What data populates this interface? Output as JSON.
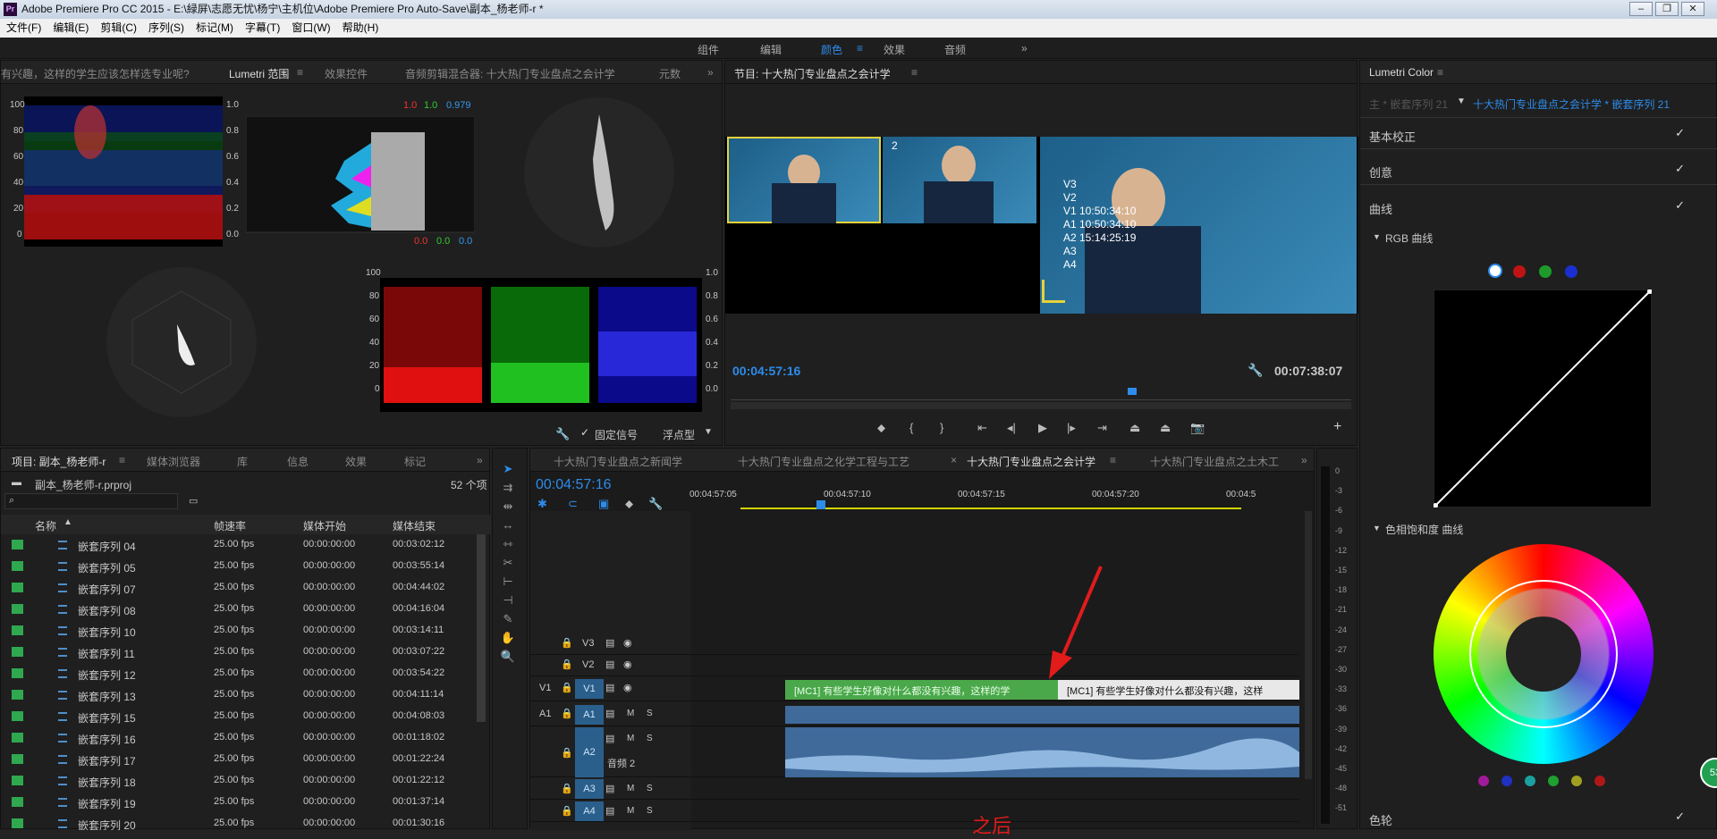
{
  "window": {
    "title": "Adobe Premiere Pro CC 2015 - E:\\緑屏\\志愿无忧\\杨宁\\主机位\\Adobe Premiere Pro Auto-Save\\副本_杨老师-r *",
    "logo": "Pr"
  },
  "menu": [
    "文件(F)",
    "编辑(E)",
    "剪辑(C)",
    "序列(S)",
    "标记(M)",
    "字幕(T)",
    "窗口(W)",
    "帮助(H)"
  ],
  "workspaces": [
    "组件",
    "编辑",
    "颜色",
    "效果",
    "音频"
  ],
  "scopes": {
    "tabs": [
      "有兴趣，这样的学生应该怎样选专业呢?",
      "Lumetri 范围",
      "效果控件",
      "音频剪辑混合器: 十大热门专业盘点之会计学",
      "元数"
    ],
    "y_labels": [
      "100",
      "80",
      "60",
      "40",
      "20",
      "0"
    ],
    "r_labels": [
      "1.0",
      "0.8",
      "0.6",
      "0.4",
      "0.2",
      "0.0"
    ],
    "hist_top": [
      "1.0",
      "1.0",
      "0.979"
    ],
    "hist_bottom": [
      "0.0",
      "0.0",
      "0.0"
    ],
    "fixed_signal": "固定信号",
    "float_label": "浮点型"
  },
  "program": {
    "title": "节目: 十大热门专业盘点之会计学",
    "timecode": "00:04:57:16",
    "duration": "00:07:38:07",
    "cam2": "2",
    "overlay": [
      "V3",
      "V2",
      "V1 10:50:34:10",
      "A1 10:50:34:10",
      "A2 15:14:25:19",
      "A3",
      "A4"
    ]
  },
  "lumetri": {
    "title": "Lumetri Color",
    "source": "主 * 嵌套序列 21",
    "target": "十大热门专业盘点之会计学 * 嵌套序列 21",
    "sections": [
      "基本校正",
      "创意",
      "曲线"
    ],
    "rgb_curve": "RGB 曲线",
    "hue_sat": "色相饱和度 曲线",
    "color_wheel": "色轮",
    "badge": "53"
  },
  "project": {
    "tabs": [
      "项目: 副本_杨老师-r",
      "媒体浏览器",
      "库",
      "信息",
      "效果",
      "标记"
    ],
    "file": "副本_杨老师-r.prproj",
    "count": "52 个项",
    "cols": [
      "名称",
      "帧速率",
      "媒体开始",
      "媒体结束"
    ],
    "rows": [
      [
        "嵌套序列 04",
        "25.00 fps",
        "00:00:00:00",
        "00:03:02:12"
      ],
      [
        "嵌套序列 05",
        "25.00 fps",
        "00:00:00:00",
        "00:03:55:14"
      ],
      [
        "嵌套序列 07",
        "25.00 fps",
        "00:00:00:00",
        "00:04:44:02"
      ],
      [
        "嵌套序列 08",
        "25.00 fps",
        "00:00:00:00",
        "00:04:16:04"
      ],
      [
        "嵌套序列 10",
        "25.00 fps",
        "00:00:00:00",
        "00:03:14:11"
      ],
      [
        "嵌套序列 11",
        "25.00 fps",
        "00:00:00:00",
        "00:03:07:22"
      ],
      [
        "嵌套序列 12",
        "25.00 fps",
        "00:00:00:00",
        "00:03:54:22"
      ],
      [
        "嵌套序列 13",
        "25.00 fps",
        "00:00:00:00",
        "00:04:11:14"
      ],
      [
        "嵌套序列 15",
        "25.00 fps",
        "00:00:00:00",
        "00:04:08:03"
      ],
      [
        "嵌套序列 16",
        "25.00 fps",
        "00:00:00:00",
        "00:01:18:02"
      ],
      [
        "嵌套序列 17",
        "25.00 fps",
        "00:00:00:00",
        "00:01:22:24"
      ],
      [
        "嵌套序列 18",
        "25.00 fps",
        "00:00:00:00",
        "00:01:22:12"
      ],
      [
        "嵌套序列 19",
        "25.00 fps",
        "00:00:00:00",
        "00:01:37:14"
      ],
      [
        "嵌套序列 20",
        "25.00 fps",
        "00:00:00:00",
        "00:01:30:16"
      ]
    ]
  },
  "timeline": {
    "tabs": [
      "十大热门专业盘点之新闻学",
      "十大热门专业盘点之化学工程与工艺",
      "十大热门专业盘点之会计学",
      "十大热门专业盘点之土木工"
    ],
    "timecode": "00:04:57:16",
    "ruler": [
      "00:04:57:05",
      "00:04:57:10",
      "00:04:57:15",
      "00:04:57:20",
      "00:04:5"
    ],
    "tracks": {
      "v3": "V3",
      "v2": "V2",
      "v1": "V1",
      "a1": "A1",
      "a2": "A2",
      "a3": "A3",
      "a4": "A4",
      "src_v1": "V1",
      "src_a1": "A1",
      "m": "M",
      "s": "S",
      "a2_name": "音频 2"
    },
    "clip": "[MC1] 有些学生好像对什么都没有兴趣，这样的学",
    "clip2": "[MC1] 有些学生好像对什么都没有兴趣，这样",
    "annotation": "之后"
  },
  "meter": [
    "0",
    "-3",
    "-6",
    "-9",
    "-12",
    "-15",
    "-18",
    "-21",
    "-24",
    "-27",
    "-30",
    "-33",
    "-36",
    "-39",
    "-42",
    "-45",
    "-48",
    "-51"
  ]
}
